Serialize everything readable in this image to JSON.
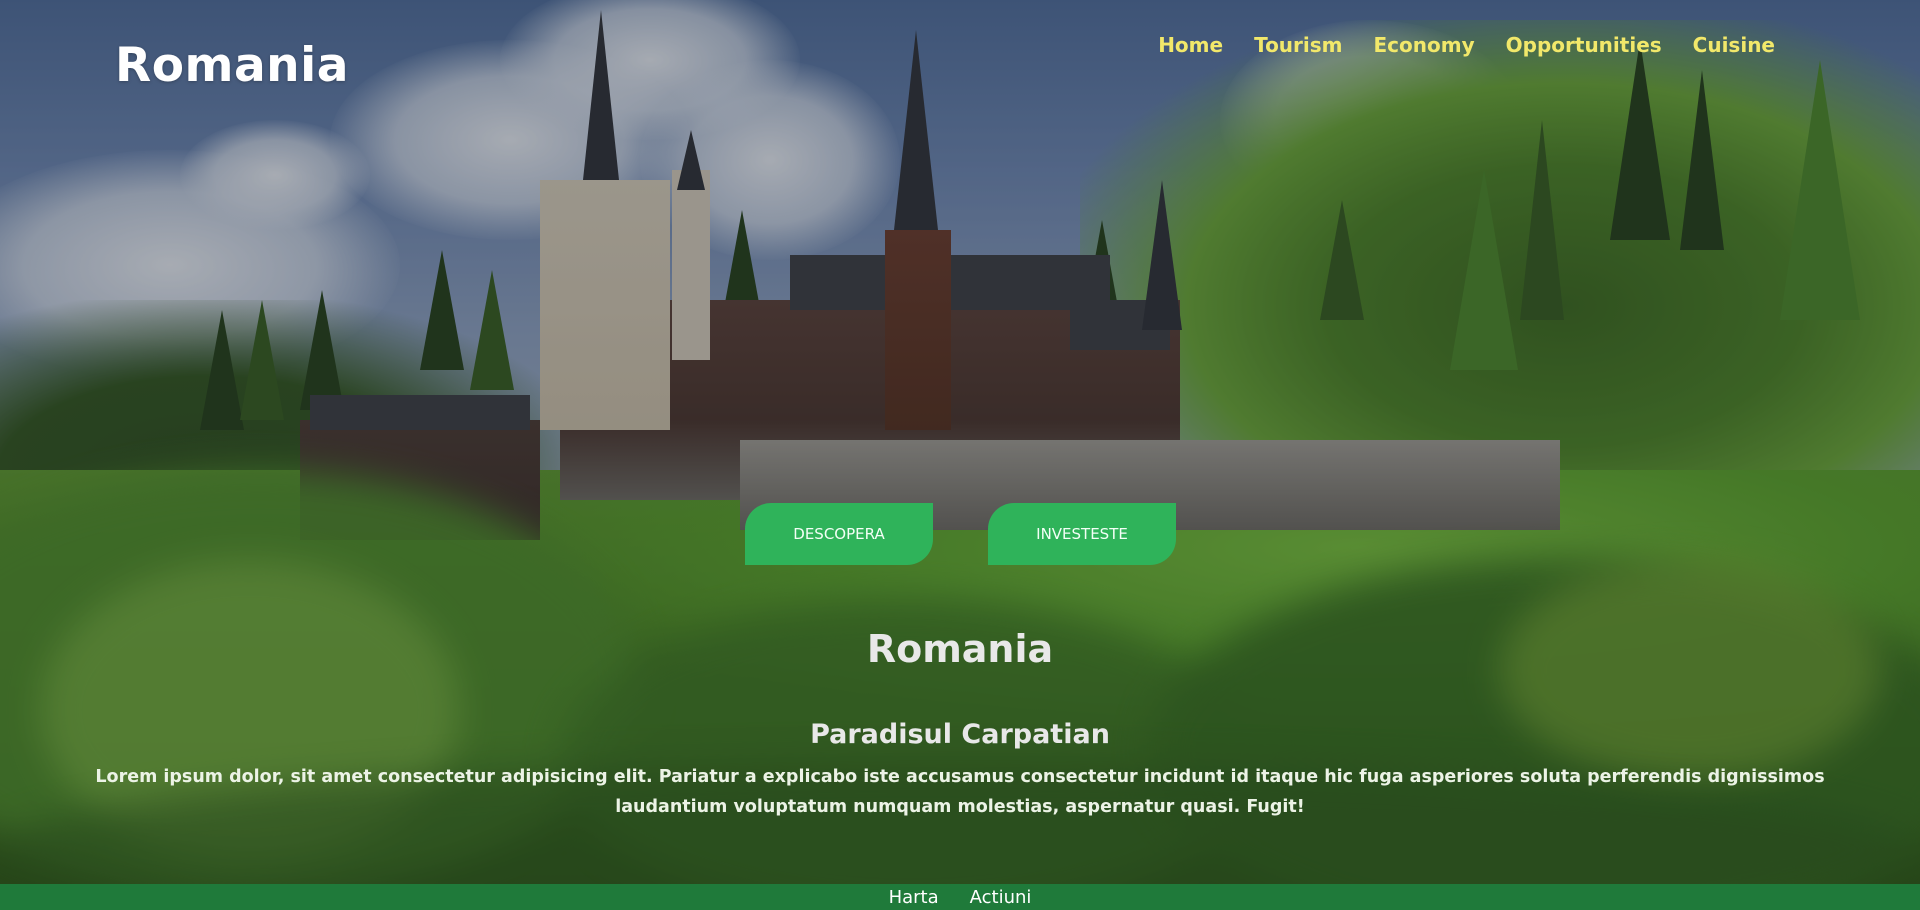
{
  "brand": {
    "title": "Romania"
  },
  "nav": {
    "items": [
      {
        "label": "Home"
      },
      {
        "label": "Tourism"
      },
      {
        "label": "Economy"
      },
      {
        "label": "Opportunities"
      },
      {
        "label": "Cuisine"
      }
    ]
  },
  "hero": {
    "buttons": [
      {
        "label": "DESCOPERA"
      },
      {
        "label": "INVESTESTE"
      }
    ],
    "title": "Romania",
    "subtitle": "Paradisul Carpatian",
    "body": "Lorem ipsum dolor, sit amet consectetur adipisicing elit. Pariatur a explicabo iste accusamus consectetur incidunt id itaque hic fuga asperiores soluta perferendis dignissimos laudantium voluptatum numquam molestias, aspernatur quasi. Fugit!"
  },
  "footer": {
    "links": [
      {
        "label": "Harta"
      },
      {
        "label": "Actiuni"
      }
    ]
  },
  "colors": {
    "nav_link": "#f2e86a",
    "button_green": "#2fb35a",
    "footer_green": "#1f7a3a",
    "brand_text": "#ffffff"
  },
  "background_image": "castle-landscape-photo"
}
